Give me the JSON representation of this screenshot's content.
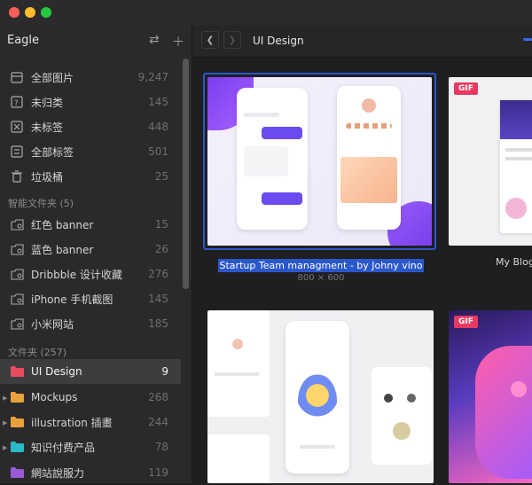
{
  "app": {
    "name": "Eagle"
  },
  "window": {
    "controls": [
      "close",
      "minimize",
      "maximize"
    ]
  },
  "sidebar": {
    "library_items": [
      {
        "label": "全部图片",
        "count": "9,247",
        "icon": "all-images-icon"
      },
      {
        "label": "未归类",
        "count": "145",
        "icon": "unfiled-icon"
      },
      {
        "label": "未标签",
        "count": "448",
        "icon": "untagged-icon"
      },
      {
        "label": "全部标签",
        "count": "501",
        "icon": "all-tags-icon"
      },
      {
        "label": "垃圾桶",
        "count": "25",
        "icon": "trash-icon"
      }
    ],
    "smart_header": "智能文件夹 (5)",
    "smart_folders": [
      {
        "label": "红色 banner",
        "count": "15"
      },
      {
        "label": "蓝色 banner",
        "count": "26"
      },
      {
        "label": "Dribbble 设计收藏",
        "count": "276"
      },
      {
        "label": "iPhone 手机截图",
        "count": "145"
      },
      {
        "label": "小米网站",
        "count": "185"
      }
    ],
    "folders_header": "文件夹 (257)",
    "folders": [
      {
        "label": "UI Design",
        "count": "9",
        "color": "#e84b5f",
        "active": true
      },
      {
        "label": "Mockups",
        "count": "268",
        "color": "#e9a23b"
      },
      {
        "label": "illustration 插畫",
        "count": "244",
        "color": "#e9a23b"
      },
      {
        "label": "知识付费产品",
        "count": "78",
        "color": "#2bb8c8"
      },
      {
        "label": "網站說服力",
        "count": "119",
        "color": "#9b59d6"
      }
    ]
  },
  "toolbar": {
    "breadcrumb": "UI Design"
  },
  "grid": {
    "items": [
      {
        "title": "Startup Team managment - by Johny vino",
        "dims": "800 × 600",
        "selected": true
      },
      {
        "title": "My Blog",
        "badge": "GIF"
      },
      {
        "title": ""
      },
      {
        "title": "",
        "badge": "GIF"
      }
    ]
  },
  "colors": {
    "accent": "#2f6ff0",
    "selection": "#2a57c9",
    "gif_badge": "#e83a62"
  }
}
